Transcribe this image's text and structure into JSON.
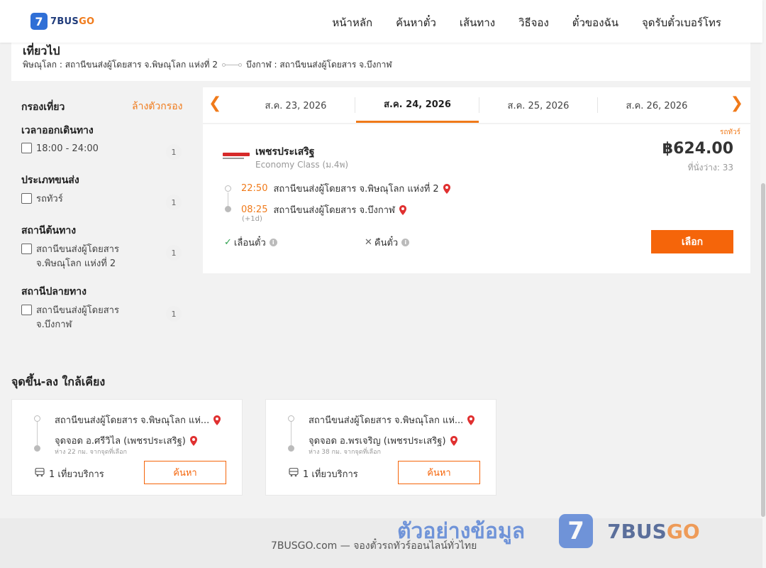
{
  "brand": {
    "logo_mark": "7",
    "name_main": "7BUS",
    "name_accent": "GO"
  },
  "nav": [
    "หน้าหลัก",
    "ค้นหาตั๋ว",
    "เส้นทาง",
    "วิธีจอง",
    "ตั๋วของฉัน",
    "จุดรับตั๋วเบอร์โทร"
  ],
  "trip": {
    "title": "เที่ยวไป",
    "from": "พิษณุโลก : สถานีขนส่งผู้โดยสาร จ.พิษณุโลก แห่งที่ 2",
    "to": "บึงกาฬ : สถานีขนส่งผู้โดยสาร จ.บึงกาฬ"
  },
  "filter": {
    "title": "กรองเที่ยว",
    "clear_label": "ล้างตัวกรอง",
    "sections": [
      {
        "title": "เวลาออกเดินทาง",
        "options": [
          {
            "label": "18:00 - 24:00",
            "count": "1"
          }
        ]
      },
      {
        "title": "ประเภทขนส่ง",
        "options": [
          {
            "label": "รถทัวร์",
            "count": "1"
          }
        ]
      },
      {
        "title": "สถานีต้นทาง",
        "options": [
          {
            "label": "สถานีขนส่งผู้โดยสาร จ.พิษณุโลก แห่งที่ 2",
            "count": "1"
          }
        ]
      },
      {
        "title": "สถานีปลายทาง",
        "options": [
          {
            "label": "สถานีขนส่งผู้โดยสาร จ.บึงกาฬ",
            "count": "1"
          }
        ]
      }
    ]
  },
  "dates": {
    "prev_icon": "chevron-left-icon",
    "next_icon": "chevron-right-icon",
    "tabs": [
      "ส.ค. 23, 2026",
      "ส.ค. 24, 2026",
      "ส.ค. 25, 2026",
      "ส.ค. 26, 2026"
    ],
    "active_index": 1
  },
  "result": {
    "tag": "รถทัวร์",
    "operator": "เพชรประเสริฐ",
    "class": "Economy Class (ม.4พ)",
    "price": "฿624.00",
    "seats": "ที่นั่งว่าง: 33",
    "depart_time": "22:50",
    "depart_station": "สถานีขนส่งผู้โดยสาร จ.พิษณุโลก แห่งที่ 2",
    "arrive_time": "08:25",
    "arrive_station": "สถานีขนส่งผู้โดยสาร จ.บึงกาฬ",
    "plus_day": "(+1d)",
    "reschedule_label": "เลื่อนตั๋ว",
    "refund_label": "คืนตั๋ว",
    "select_label": "เลือก"
  },
  "nearby": {
    "title": "จุดขึ้น-ลง ใกล้เคียง",
    "cards": [
      {
        "from": "สถานีขนส่งผู้โดยสาร จ.พิษณุโลก แห่...",
        "to": "จุดจอด อ.ศรีวิไล (เพชรประเสริฐ)",
        "distance": "ห่าง 22 กม. จากจุดที่เลือก",
        "trips": "1 เที่ยวบริการ",
        "button": "ค้นหา"
      },
      {
        "from": "สถานีขนส่งผู้โดยสาร จ.พิษณุโลก แห่...",
        "to": "จุดจอด อ.พรเจริญ (เพชรประเสริฐ)",
        "distance": "ห่าง 38 กม. จากจุดที่เลือก",
        "trips": "1 เที่ยวบริการ",
        "button": "ค้นหา"
      }
    ]
  },
  "footer": {
    "text": "7BUSGO.com — จองตั๋วรถทัวร์ออนไลน์ทั่วไทย"
  },
  "watermark": {
    "text": "ตัวอย่างข้อมูล",
    "mark": "7",
    "brand_main": "7BUS",
    "brand_accent": "GO"
  },
  "colors": {
    "accent": "#f07a1a",
    "button": "#f5650a",
    "brand_blue": "#2f6fd6",
    "check_green": "#2ea04f"
  }
}
